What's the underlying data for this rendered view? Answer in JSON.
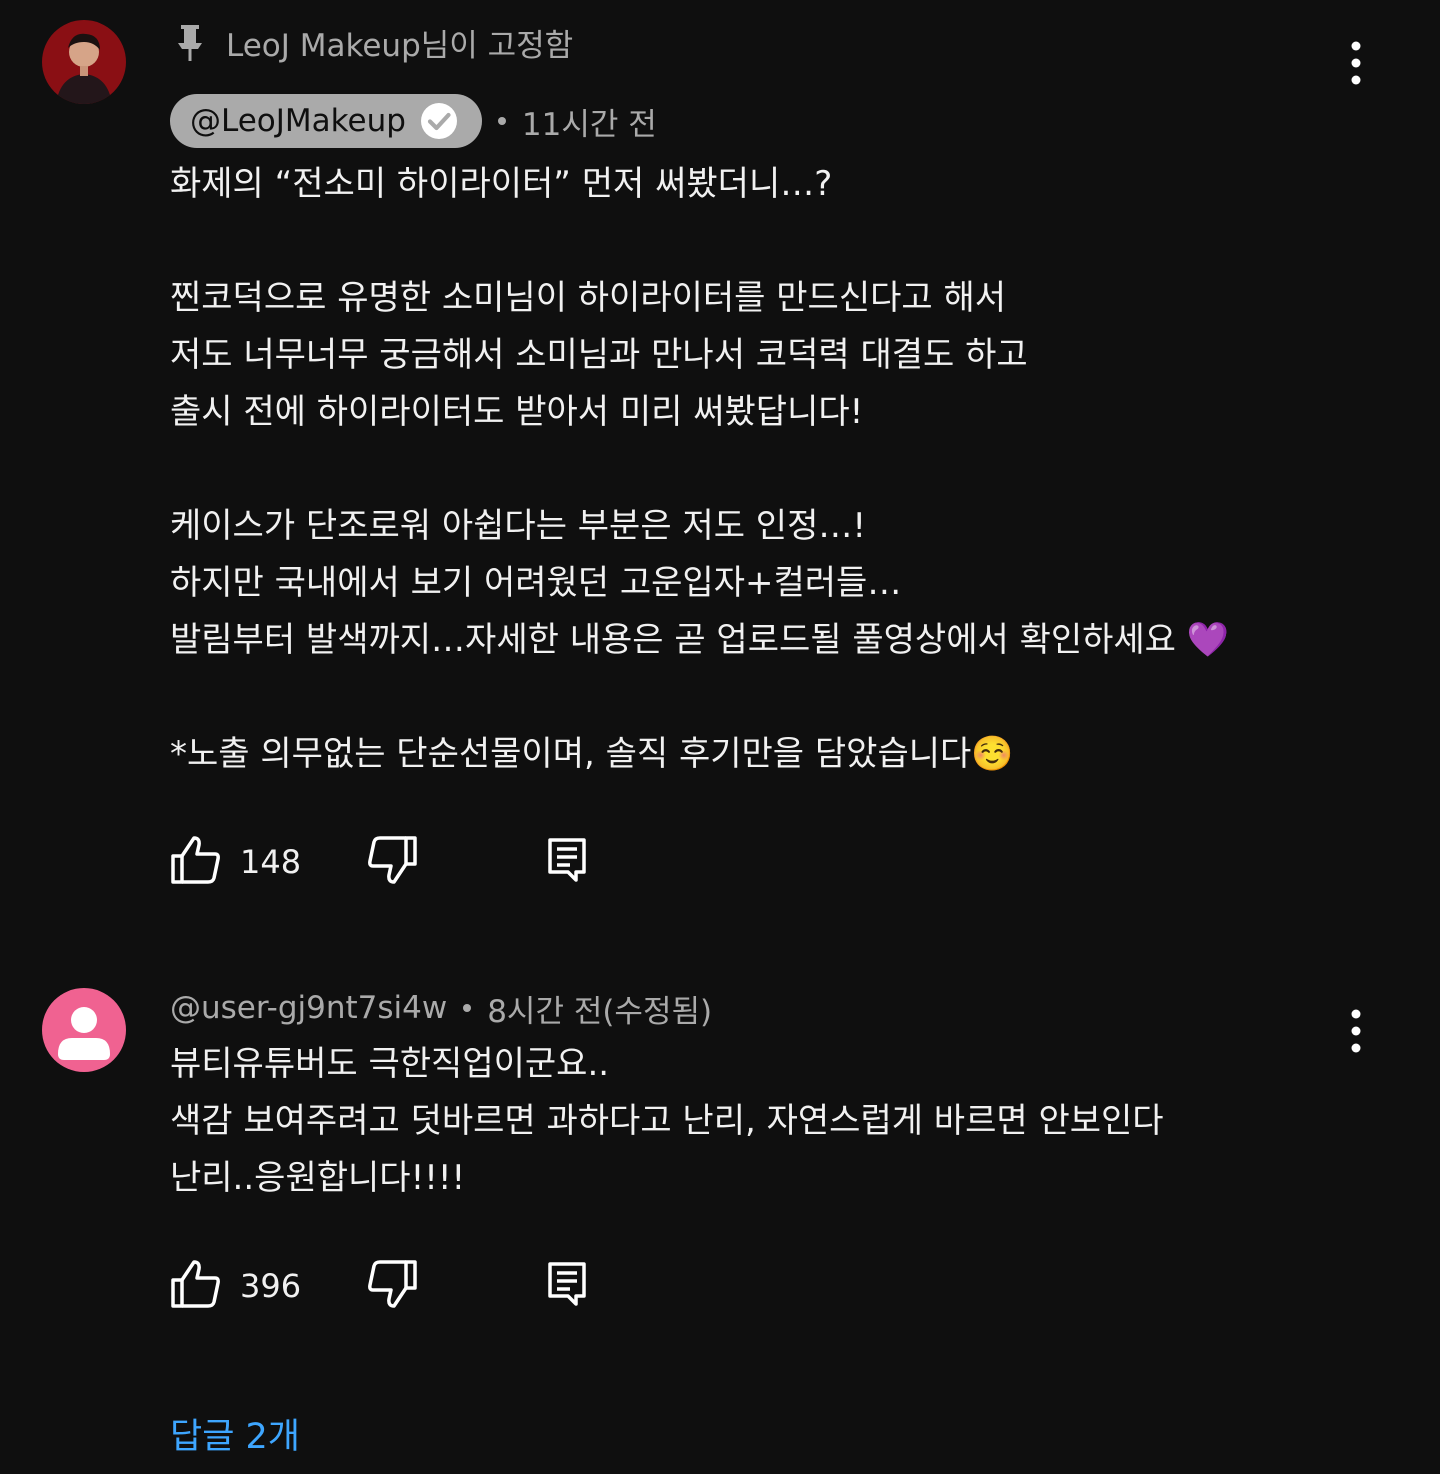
{
  "comments": [
    {
      "pinned_text": "LeoJ Makeup님이 고정함",
      "author": "@LeoJMakeup",
      "timestamp": "11시간 전",
      "verified": true,
      "body": "화제의 “전소미 하이라이터” 먼저 써봤더니…?\n\n찐코덕으로 유명한 소미님이 하이라이터를 만드신다고 해서\n저도 너무너무 궁금해서 소미님과 만나서 코덕력 대결도 하고\n출시 전에 하이라이터도 받아서 미리 써봤답니다!\n\n케이스가 단조로워 아쉽다는 부분은 저도 인정…!\n하지만 국내에서 보기 어려웠던 고운입자+컬러들…\n발림부터 발색까지…자세한 내용은 곧 업로드될 풀영상에서 확인하세요 💜\n\n*노출 의무없는 단순선물이며, 솔직 후기만을 담았습니다☺️",
      "likes": "148",
      "icons": [
        "pin-icon",
        "verified-icon",
        "more-vert-icon",
        "thumb-up-icon",
        "thumb-down-icon",
        "reply-icon"
      ]
    },
    {
      "author": "@user-gj9nt7si4w",
      "timestamp": "8시간 전(수정됨)",
      "body": "뷰티유튜버도 극한직업이군요..\n색감 보여주려고 덧바르면 과하다고 난리, 자연스럽게 바르면 안보인다\n난리..응원합니다!!!!",
      "likes": "396",
      "icons": [
        "more-vert-icon",
        "thumb-up-icon",
        "thumb-down-icon",
        "reply-icon"
      ]
    }
  ],
  "replies_label": "답글 2개",
  "colors": {
    "background": "#0f0f0f",
    "text": "#f1f1f1",
    "secondary_text": "#aaaaaa",
    "link": "#3ea6ff",
    "default_avatar": "#f06291"
  }
}
